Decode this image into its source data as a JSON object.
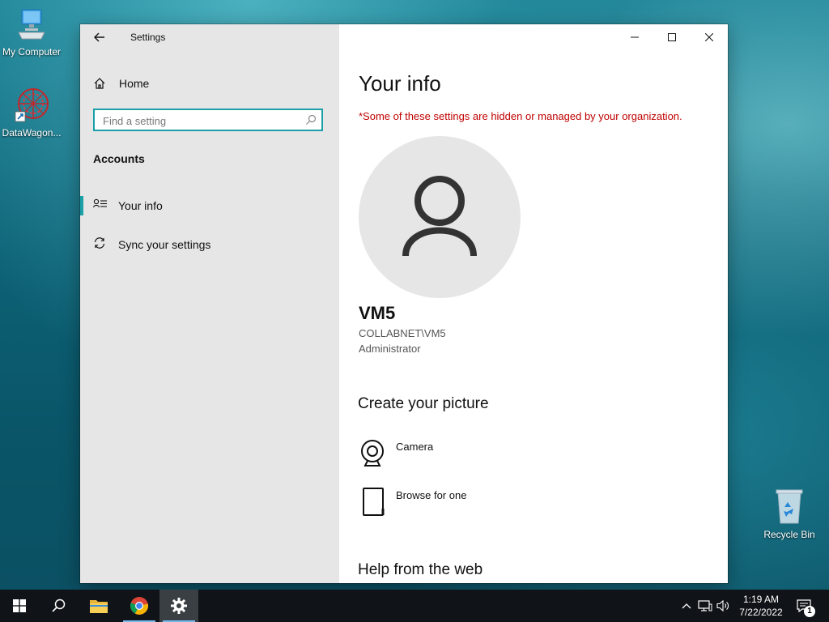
{
  "desktop": {
    "icons": [
      {
        "label": "My Computer",
        "icon": "computer-icon"
      },
      {
        "label": "DataWagon...",
        "icon": "datawagon-icon"
      },
      {
        "label": "Recycle Bin",
        "icon": "recycle-bin-icon"
      }
    ]
  },
  "window": {
    "title": "Settings",
    "controls": {
      "minimize": "minimize-icon",
      "maximize": "maximize-icon",
      "close": "close-icon"
    }
  },
  "sidebar": {
    "home_label": "Home",
    "search_placeholder": "Find a setting",
    "section_title": "Accounts",
    "items": [
      {
        "label": "Your info",
        "icon": "contact-card-icon",
        "active": true
      },
      {
        "label": "Sync your settings",
        "icon": "sync-icon",
        "active": false
      }
    ]
  },
  "main": {
    "title": "Your info",
    "managed_note": "*Some of these settings are hidden or managed by your organization.",
    "user": {
      "name": "VM5",
      "domain": "COLLABNET\\VM5",
      "role": "Administrator"
    },
    "create_picture_heading": "Create your picture",
    "picture_options": [
      {
        "label": "Camera",
        "icon": "camera-icon"
      },
      {
        "label": "Browse for one",
        "icon": "browse-icon"
      }
    ],
    "help_heading": "Help from the web"
  },
  "taskbar": {
    "apps": [
      "start-icon",
      "search-icon",
      "file-explorer-icon",
      "chrome-icon",
      "settings-icon"
    ],
    "tray": [
      "chevron-up-icon",
      "network-icon",
      "volume-icon"
    ],
    "time": "1:19 AM",
    "date": "7/22/2022",
    "notification_count": "1"
  },
  "colors": {
    "accent": "#1aa0a6",
    "warning_text": "#c00000",
    "sidebar_bg": "#e6e6e6",
    "taskbar_bg": "#101418"
  }
}
